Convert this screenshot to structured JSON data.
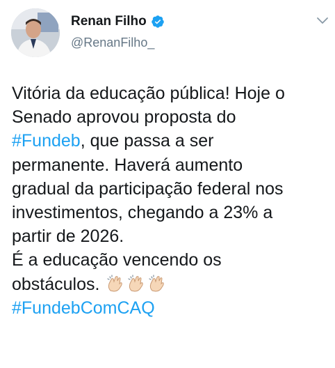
{
  "author": {
    "display_name": "Renan Filho",
    "handle": "@RenanFilho_",
    "verified": true
  },
  "tweet": {
    "line1": "Vitória da educação pública! Hoje o",
    "line2": "Senado aprovou proposta do",
    "hashtag1": "#Fundeb",
    "line3_rest": ", que passa a ser",
    "line4": "permanente. Haverá aumento",
    "line5": "gradual da participação federal nos",
    "line6": "investimentos, chegando a 23% a",
    "line7": "partir de 2026.",
    "line8": "É a educação vencendo os",
    "line9": "obstáculos.",
    "emoji": "clapping-hands x3",
    "hashtag2": "#FundebComCAQ"
  },
  "colors": {
    "text": "#14171a",
    "secondary": "#657786",
    "link": "#1da1f2",
    "verified": "#1da1f2"
  }
}
